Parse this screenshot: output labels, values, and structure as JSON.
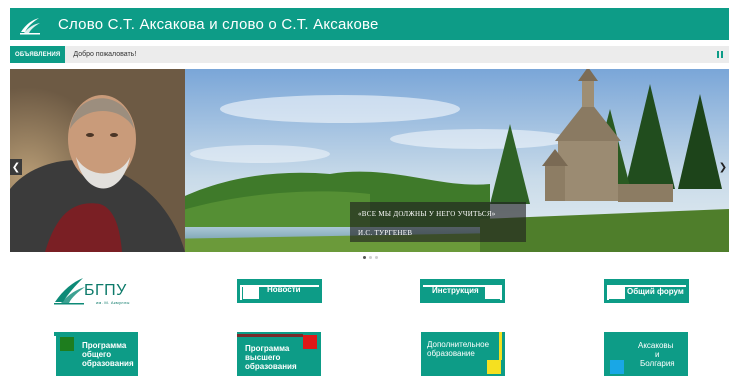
{
  "header": {
    "title": "Слово С.Т. Аксакова и слово о С.Т. Аксакове",
    "logo_icon": "bgpu-swoosh-icon"
  },
  "ticker": {
    "badge": "ОБЪЯВЛЕНИЯ",
    "text": "Добро пожаловать!",
    "pause_icon": "pause-icon"
  },
  "slider": {
    "quote": "«ВСЕ МЫ ДОЛЖНЫ У НЕГО УЧИТЬСЯ»",
    "author": "И.С. ТУРГЕНЕВ",
    "prev_icon": "chevron-left-icon",
    "next_icon": "chevron-right-icon",
    "prev_symbol": "❮",
    "next_symbol": "❯",
    "slides_total": 3,
    "active_slide": 1
  },
  "brand": {
    "name": "БГПУ",
    "sub": "им. М. Акмуллы"
  },
  "tiles_row1": [
    {
      "label": "Новости"
    },
    {
      "label": "Инструкция"
    },
    {
      "label": "Общий форум"
    }
  ],
  "tiles_row2": [
    {
      "label_lines": [
        "Программа",
        "общего",
        "образования"
      ]
    },
    {
      "label_lines": [
        "Программа",
        "высшего",
        "образования"
      ]
    },
    {
      "label_lines": [
        "Дополнительное",
        "образование"
      ]
    },
    {
      "label_lines": [
        "Аксаковы",
        "и",
        "Болгария"
      ]
    }
  ],
  "colors": {
    "brand_teal": "#0d9c87",
    "tile_green_square": "#1e7d1e",
    "tile_red_square": "#e01818",
    "tile_yellow_square": "#f5e020",
    "tile_blue_square": "#19a7e6"
  }
}
